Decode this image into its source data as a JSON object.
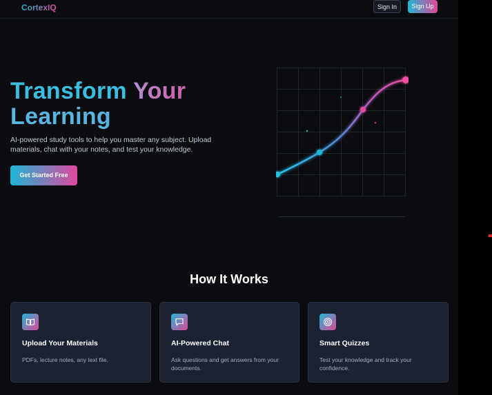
{
  "nav": {
    "logo": "CortexIQ",
    "sign_in": "Sign In",
    "sign_up": "Sign Up"
  },
  "hero": {
    "title_word1": "Transform",
    "title_word2": "Your",
    "title_line2": "Learning",
    "subtitle": "AI-powered study tools to help you master any subject. Upload materials, chat with your notes, and test your knowledge.",
    "cta": "Get Started Free"
  },
  "how_it_works": {
    "title": "How It Works",
    "cards": [
      {
        "icon": "book-icon",
        "title": "Upload Your Materials",
        "desc": "PDFs, lecture notes, any text file."
      },
      {
        "icon": "chat-icon",
        "title": "AI-Powered Chat",
        "desc": "Ask questions and get answers from your documents."
      },
      {
        "icon": "target-icon",
        "title": "Smart Quizzes",
        "desc": "Test your knowledge and track your confidence."
      }
    ]
  },
  "colors": {
    "accent_cyan": "#1fb6d4",
    "accent_pink": "#e0479b",
    "background": "#0b0c10",
    "card_bg": "#1b2232"
  }
}
